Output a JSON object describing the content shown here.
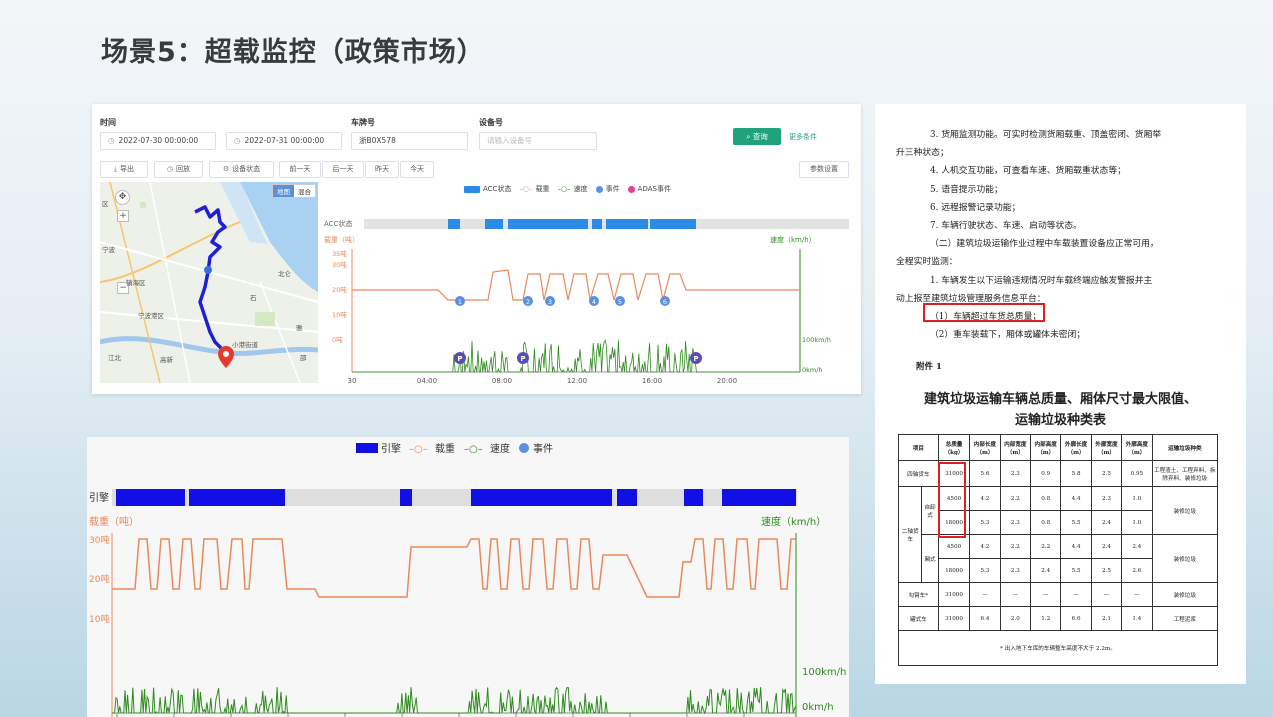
{
  "slide": {
    "title": "场景5：超载监控（政策市场）"
  },
  "monitor": {
    "filters": {
      "time_label": "时间",
      "start_time": "2022-07-30 00:00:00",
      "end_time": "2022-07-31 00:00:00",
      "plate_label": "车牌号",
      "plate_value": "浙B0X578",
      "device_label": "设备号",
      "device_placeholder": "请输入设备号",
      "query_button": "查询",
      "more_conditions": "更多条件"
    },
    "toolbar": {
      "export": "导出",
      "playback": "回放",
      "device_status": "设备状态",
      "prev_day": "前一天",
      "next_day": "后一天",
      "yesterday": "昨天",
      "today": "今天",
      "params": "参数设置"
    },
    "map": {
      "toggle_map": "地图",
      "toggle_hybrid": "混合",
      "labels": [
        "镇海区",
        "宁波港区",
        "小港街道",
        "北仑",
        "区",
        "宁波",
        "江北",
        "高新",
        "石",
        "雅",
        "邵"
      ]
    },
    "legend": {
      "acc": "ACC状态",
      "load": "载重",
      "speed": "速度",
      "event": "事件",
      "adas": "ADAS事件"
    },
    "chart": {
      "acc_label": "ACC状态",
      "load_axis": "载重（吨）",
      "speed_axis": "速度（km/h）",
      "y_ticks": [
        "35吨",
        "30吨",
        "20吨",
        "10吨",
        "0吨"
      ],
      "speed_ticks": [
        "100km/h",
        "0km/h"
      ],
      "x_ticks": [
        "30",
        "04:00",
        "08:00",
        "12:00",
        "16:00",
        "20:00"
      ],
      "event_numbers": [
        "1",
        "2",
        "3",
        "4",
        "5",
        "6"
      ],
      "park_marker": "P"
    }
  },
  "trend": {
    "legend": {
      "engine": "引擎",
      "load": "载重",
      "speed": "速度",
      "event": "事件"
    },
    "engine_label": "引擎",
    "load_axis": "载重（吨）",
    "speed_axis": "速度（km/h）",
    "y_ticks": [
      "30吨",
      "20吨",
      "10吨"
    ],
    "speed_ticks": [
      "100km/h",
      "0km/h"
    ]
  },
  "document": {
    "lines": [
      "3. 货厢监测功能。可实时检测货厢载重、顶盖密闭、货厢举",
      "升三种状态；",
      "4. 人机交互功能，可查看车速、货厢载重状态等；",
      "5. 语音提示功能；",
      "6. 远程报警记录功能；",
      "7. 车辆行驶状态、车速、启动等状态。",
      "（二）建筑垃圾运输作业过程中车载装置设备应正常可用，",
      "全程实时监测：",
      "1. 车辆发生以下运输违规情况时车载终端应触发警报并主",
      "动上报至建筑垃圾管理服务信息平台：",
      "（1）车辆超过车货总质量；",
      "（2）重车装载下，厢体或罐体未密闭；"
    ],
    "annex": "附件 1",
    "title_line1": "建筑垃圾运输车辆总质量、厢体尺寸最大限值、",
    "title_line2": "运输垃圾种类表",
    "table": {
      "headers": [
        "项目",
        "总质量（kg）",
        "内部长度（m）",
        "内部宽度（m）",
        "内部高度（m）",
        "外廓长度（m）",
        "外廓宽度（m）",
        "外廓高度（m）",
        "运输垃圾种类"
      ],
      "rows": [
        [
          "四轴货车",
          "",
          "31000",
          "5.6",
          "2.3",
          "0.9",
          "5.8",
          "2.5",
          "0.95",
          "工程渣土、工程弃料、拆除弃料、装修垃圾"
        ],
        [
          "二轴货车",
          "自卸式",
          "4500",
          "4.2",
          "2.2",
          "0.8",
          "4.4",
          "2.3",
          "1.0",
          "装修垃圾"
        ],
        [
          "",
          "",
          "18000",
          "5.3",
          "2.3",
          "0.8",
          "5.5",
          "2.4",
          "1.0",
          ""
        ],
        [
          "",
          "厢式",
          "4500",
          "4.2",
          "2.2",
          "2.2",
          "4.4",
          "2.4",
          "2.4",
          "装修垃圾"
        ],
        [
          "",
          "",
          "18000",
          "5.3",
          "2.3",
          "2.4",
          "5.5",
          "2.5",
          "2.6",
          ""
        ],
        [
          "勾臂车*",
          "",
          "31000",
          "—",
          "—",
          "—",
          "—",
          "—",
          "—",
          "装修垃圾"
        ],
        [
          "罐式车",
          "",
          "31000",
          "6.4",
          "2.0",
          "1.2",
          "6.6",
          "2.1",
          "1.4",
          "工程泥浆"
        ]
      ],
      "footnote": "* 出入地下车库的车辆整车高度不大于 2.2m。"
    }
  },
  "colors": {
    "accent_green": "#20a27c",
    "load_orange": "#e8895a",
    "speed_green": "#2e8b1e",
    "acc_blue": "#2b8ce8",
    "engine_blue": "#1010e6",
    "event_blue": "#5b8fe0",
    "adas_pink": "#e8408a",
    "highlight_red": "#e02020"
  }
}
